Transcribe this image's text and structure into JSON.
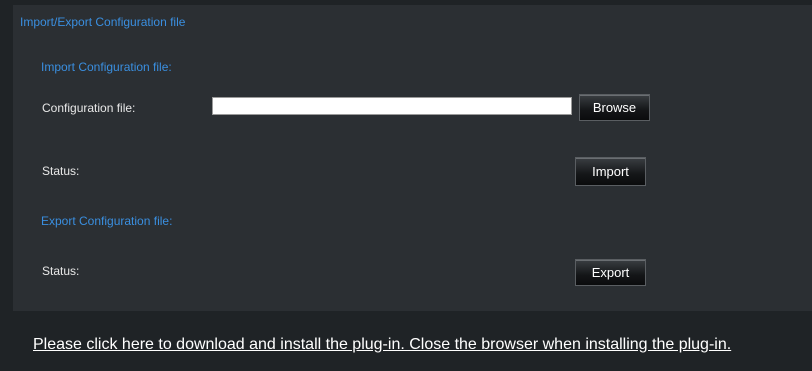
{
  "panel": {
    "title": "Import/Export Configuration file"
  },
  "import_section": {
    "title": "Import Configuration file:",
    "config_file_label": "Configuration file:",
    "config_file_value": "",
    "browse_label": "Browse",
    "status_label": "Status:",
    "import_label": "Import"
  },
  "export_section": {
    "title": "Export Configuration file:",
    "status_label": "Status:",
    "export_label": "Export"
  },
  "plugin_link": {
    "text": "Please click here to download and install the plug-in. Close the browser when installing the plug-in."
  },
  "colors": {
    "page_background": "#1f2326",
    "panel_background": "#2b2f33",
    "heading_accent": "#3a8fe0",
    "label_text": "#e8e8e8"
  }
}
